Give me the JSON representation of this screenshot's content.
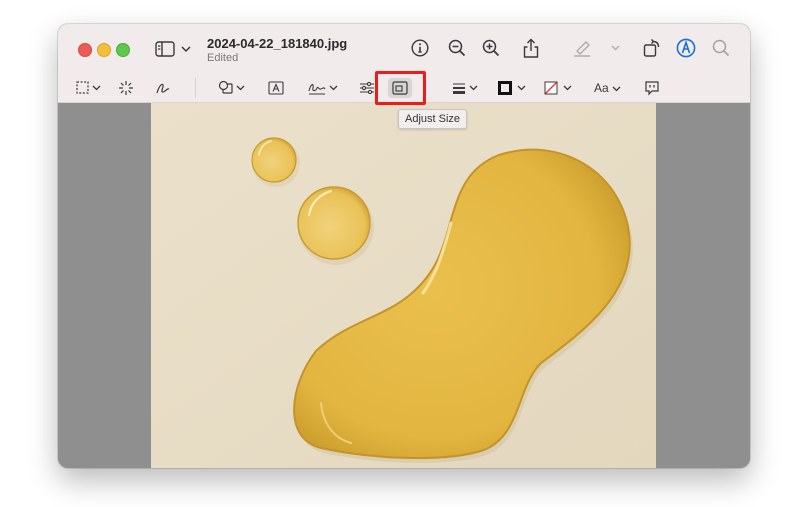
{
  "window": {
    "title": "2024-04-22_181840.jpg",
    "subtitle": "Edited"
  },
  "toolbar": {
    "format_label": "Aa",
    "adjust_size_tooltip": "Adjust Size"
  },
  "colors": {
    "titlebar_bg": "#f1ebec",
    "highlight_border": "#ef1b1b",
    "markup_accent": "#1a6fd6",
    "image_background": "#e7dcc5",
    "oil_color": "#e2b540"
  },
  "icons": [
    "sidebar-icon",
    "info-icon",
    "zoom-out-icon",
    "zoom-in-icon",
    "share-icon",
    "highlight-pen-icon",
    "rotate-icon",
    "markup-icon",
    "search-icon",
    "rectangular-selection-icon",
    "instant-alpha-icon",
    "sketch-icon",
    "shapes-icon",
    "text-box-icon",
    "sign-icon",
    "adjust-color-icon",
    "adjust-size-icon",
    "shape-style-icon",
    "border-color-icon",
    "fill-color-icon",
    "text-style-icon",
    "image-description-icon"
  ]
}
